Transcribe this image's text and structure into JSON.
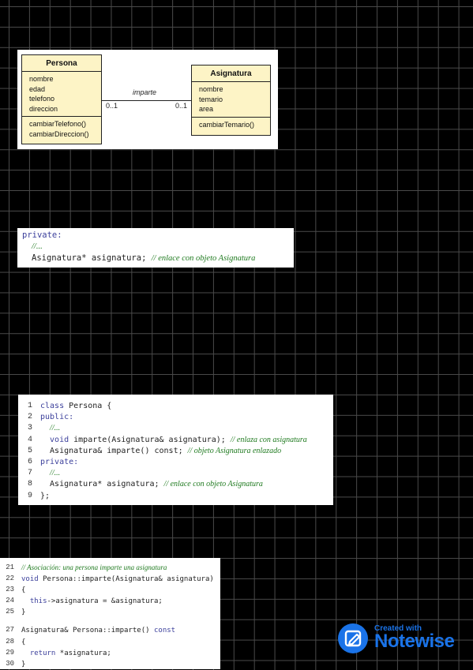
{
  "uml": {
    "persona": {
      "title": "Persona",
      "attributes": [
        "nombre",
        "edad",
        "telefono",
        "direccion"
      ],
      "methods": [
        "cambiarTelefono()",
        "cambiarDireccion()"
      ]
    },
    "asignatura": {
      "title": "Asignatura",
      "attributes": [
        "nombre",
        "temario",
        "area"
      ],
      "methods": [
        "cambiarTemario()"
      ]
    },
    "association": {
      "label": "imparte",
      "left_mult": "0..1",
      "right_mult": "0..1"
    }
  },
  "snippet1": {
    "line1": "private:",
    "line2": "//...",
    "line3_code": "Asignatura* asignatura;",
    "line3_comment": "// enlace con objeto Asignatura"
  },
  "snippet2": {
    "lines": [
      {
        "n": "1",
        "kw": "class",
        "code": " Persona {",
        "comment": ""
      },
      {
        "n": "2",
        "kw": "public:",
        "code": "",
        "comment": ""
      },
      {
        "n": "3",
        "kw": "",
        "code": "  ",
        "comment": "//..."
      },
      {
        "n": "4",
        "kw": "  void",
        "code": " imparte(Asignatura& asignatura); ",
        "comment": "// enlaza con asignatura"
      },
      {
        "n": "5",
        "kw": "",
        "code": "  Asignatura& imparte() const; ",
        "comment": "// objeto Asignatura enlazado"
      },
      {
        "n": "6",
        "kw": "private:",
        "code": "",
        "comment": ""
      },
      {
        "n": "7",
        "kw": "",
        "code": "  ",
        "comment": "//..."
      },
      {
        "n": "8",
        "kw": "",
        "code": "  Asignatura* asignatura; ",
        "comment": "// enlace con objeto Asignatura"
      },
      {
        "n": "9",
        "kw": "",
        "code": "};",
        "comment": ""
      }
    ]
  },
  "snippet3": {
    "lines": [
      {
        "n": "21",
        "kw": "",
        "code": "",
        "comment": "// Asociación: una persona imparte una asignatura"
      },
      {
        "n": "22",
        "kw": "void",
        "code": " Persona::imparte(Asignatura& asignatura)",
        "comment": ""
      },
      {
        "n": "23",
        "kw": "",
        "code": "{",
        "comment": ""
      },
      {
        "n": "24",
        "kw": "  this",
        "code": "->asignatura = &asignatura;",
        "comment": ""
      },
      {
        "n": "25",
        "kw": "",
        "code": "}",
        "comment": ""
      },
      {
        "n": "",
        "kw": "",
        "code": "",
        "comment": ""
      },
      {
        "n": "27",
        "kw": "",
        "code": "Asignatura& Persona::imparte() ",
        "comment": "",
        "kw2": "const"
      },
      {
        "n": "28",
        "kw": "",
        "code": "{",
        "comment": ""
      },
      {
        "n": "29",
        "kw": "  return",
        "code": " *asignatura;",
        "comment": ""
      },
      {
        "n": "30",
        "kw": "",
        "code": "}",
        "comment": ""
      }
    ]
  },
  "badge": {
    "created": "Created with",
    "brand": "Notewise",
    "icon": "pencil-icon",
    "color": "#1a73e8"
  }
}
